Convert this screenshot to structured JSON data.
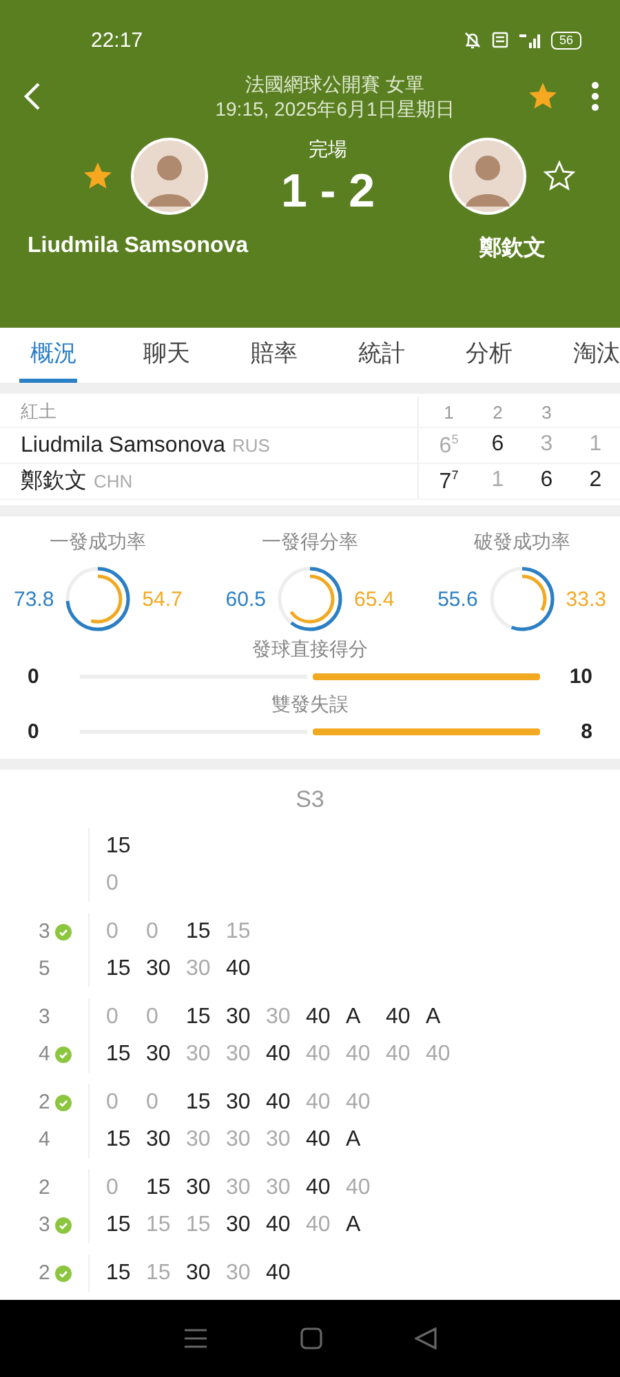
{
  "status_bar": {
    "time": "22:17",
    "battery": "56"
  },
  "header": {
    "title": "法國網球公開賽 女單",
    "subtitle": "19:15, 2025年6月1日星期日",
    "favorite": true
  },
  "match": {
    "status": "完場",
    "score": "1 - 2",
    "players": [
      {
        "name": "Liudmila Samsonova",
        "favorite": true
      },
      {
        "name": "鄭欽文",
        "favorite": false
      }
    ]
  },
  "tabs": [
    {
      "label": "概況",
      "selected": true
    },
    {
      "label": "聊天",
      "selected": false
    },
    {
      "label": "賠率",
      "selected": false
    },
    {
      "label": "統計",
      "selected": false
    },
    {
      "label": "分析",
      "selected": false
    },
    {
      "label": "淘汰",
      "selected": false
    }
  ],
  "scoreboard": {
    "surface": "紅土",
    "columns": [
      "1",
      "2",
      "3"
    ],
    "rows": [
      {
        "name": "Liudmila Samsonova",
        "country": "RUS",
        "scores": [
          {
            "v": "6",
            "tb": "5",
            "won": false
          },
          {
            "v": "6",
            "won": true
          },
          {
            "v": "3",
            "won": false
          },
          {
            "v": "1",
            "won": false
          }
        ]
      },
      {
        "name": "鄭欽文",
        "country": "CHN",
        "scores": [
          {
            "v": "7",
            "tb": "7",
            "won": true
          },
          {
            "v": "1",
            "won": false
          },
          {
            "v": "6",
            "won": true
          },
          {
            "v": "2",
            "won": true
          }
        ]
      }
    ]
  },
  "rings": [
    {
      "label": "一發成功率",
      "left": {
        "value": "73.8"
      },
      "right": {
        "value": "54.7"
      }
    },
    {
      "label": "一發得分率",
      "left": {
        "value": "60.5"
      },
      "right": {
        "value": "65.4"
      }
    },
    {
      "label": "破發成功率",
      "left": {
        "value": "55.6"
      },
      "right": {
        "value": "33.3"
      }
    }
  ],
  "bars": [
    {
      "label": "發球直接得分",
      "left": {
        "value": "0",
        "level": 0
      },
      "right": {
        "value": "10",
        "level": 1
      }
    },
    {
      "label": "雙發失誤",
      "left": {
        "value": "0",
        "level": 0
      },
      "right": {
        "value": "8",
        "level": 1
      }
    }
  ],
  "points": {
    "title": "S3",
    "games": [
      [
        {
          "points": [
            {
              "v": "15",
              "won": true
            }
          ]
        },
        {
          "points": [
            {
              "v": "0",
              "won": false
            }
          ]
        }
      ],
      [
        {
          "count": "3",
          "served": true,
          "points": [
            {
              "v": "0",
              "won": false
            },
            {
              "v": "0",
              "won": false
            },
            {
              "v": "15",
              "won": true
            },
            {
              "v": "15",
              "won": false
            }
          ]
        },
        {
          "count": "5",
          "served": false,
          "points": [
            {
              "v": "15",
              "won": true
            },
            {
              "v": "30",
              "won": true
            },
            {
              "v": "30",
              "won": false
            },
            {
              "v": "40",
              "won": true
            }
          ]
        }
      ],
      [
        {
          "count": "3",
          "served": false,
          "points": [
            {
              "v": "0",
              "won": false
            },
            {
              "v": "0",
              "won": false
            },
            {
              "v": "15",
              "won": true
            },
            {
              "v": "30",
              "won": true
            },
            {
              "v": "30",
              "won": false
            },
            {
              "v": "40",
              "won": true
            },
            {
              "v": "A",
              "won": true
            },
            {
              "v": "40",
              "won": true
            },
            {
              "v": "A",
              "won": true
            }
          ]
        },
        {
          "count": "4",
          "served": true,
          "points": [
            {
              "v": "15",
              "won": true
            },
            {
              "v": "30",
              "won": true
            },
            {
              "v": "30",
              "won": false
            },
            {
              "v": "30",
              "won": false
            },
            {
              "v": "40",
              "won": true
            },
            {
              "v": "40",
              "won": false
            },
            {
              "v": "40",
              "won": false
            },
            {
              "v": "40",
              "won": false
            },
            {
              "v": "40",
              "won": false
            }
          ]
        }
      ],
      [
        {
          "count": "2",
          "served": true,
          "points": [
            {
              "v": "0",
              "won": false
            },
            {
              "v": "0",
              "won": false
            },
            {
              "v": "15",
              "won": true
            },
            {
              "v": "30",
              "won": true
            },
            {
              "v": "40",
              "won": true
            },
            {
              "v": "40",
              "won": false
            },
            {
              "v": "40",
              "won": false
            }
          ]
        },
        {
          "count": "4",
          "served": false,
          "points": [
            {
              "v": "15",
              "won": true
            },
            {
              "v": "30",
              "won": true
            },
            {
              "v": "30",
              "won": false
            },
            {
              "v": "30",
              "won": false
            },
            {
              "v": "30",
              "won": false
            },
            {
              "v": "40",
              "won": true
            },
            {
              "v": "A",
              "won": true
            }
          ]
        }
      ],
      [
        {
          "count": "2",
          "served": false,
          "points": [
            {
              "v": "0",
              "won": false
            },
            {
              "v": "15",
              "won": true
            },
            {
              "v": "30",
              "won": true
            },
            {
              "v": "30",
              "won": false
            },
            {
              "v": "30",
              "won": false
            },
            {
              "v": "40",
              "won": true
            },
            {
              "v": "40",
              "won": false
            }
          ]
        },
        {
          "count": "3",
          "served": true,
          "points": [
            {
              "v": "15",
              "won": true
            },
            {
              "v": "15",
              "won": false
            },
            {
              "v": "15",
              "won": false
            },
            {
              "v": "30",
              "won": true
            },
            {
              "v": "40",
              "won": true
            },
            {
              "v": "40",
              "won": false
            },
            {
              "v": "A",
              "won": true
            }
          ]
        }
      ],
      [
        {
          "count": "2",
          "served": true,
          "points": [
            {
              "v": "15",
              "won": true
            },
            {
              "v": "15",
              "won": false
            },
            {
              "v": "30",
              "won": true
            },
            {
              "v": "30",
              "won": false
            },
            {
              "v": "40",
              "won": true
            }
          ]
        }
      ]
    ]
  }
}
